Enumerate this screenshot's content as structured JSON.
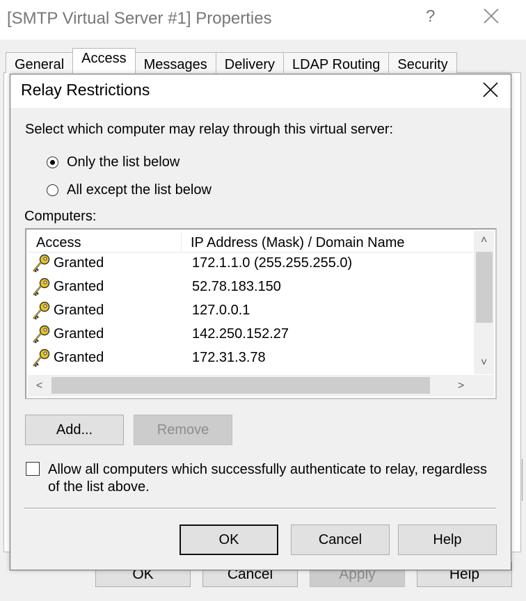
{
  "parent": {
    "title": "[SMTP Virtual Server #1] Properties",
    "help_glyph": "?",
    "tabs": [
      {
        "label": "General"
      },
      {
        "label": "Access"
      },
      {
        "label": "Messages"
      },
      {
        "label": "Delivery"
      },
      {
        "label": "LDAP Routing"
      },
      {
        "label": "Security"
      }
    ],
    "active_tab": "Access",
    "buttons": {
      "ok": "OK",
      "cancel": "Cancel",
      "apply": "Apply",
      "help": "Help"
    }
  },
  "dialog": {
    "title": "Relay Restrictions",
    "prompt": "Select which computer may relay through this virtual server:",
    "radio_only": "Only the list below",
    "radio_all_except": "All except the list below",
    "selected_radio": "Only the list below",
    "computers_label": "Computers:",
    "columns": {
      "access": "Access",
      "ip": "IP Address (Mask) / Domain Name"
    },
    "rows": [
      {
        "access": "Granted",
        "ip": "172.1.1.0 (255.255.255.0)",
        "icon": "key-icon"
      },
      {
        "access": "Granted",
        "ip": "52.78.183.150",
        "icon": "key-icon"
      },
      {
        "access": "Granted",
        "ip": "127.0.0.1",
        "icon": "key-icon"
      },
      {
        "access": "Granted",
        "ip": "142.250.152.27",
        "icon": "key-icon"
      },
      {
        "access": "Granted",
        "ip": "172.31.3.78",
        "icon": "key-icon"
      }
    ],
    "add_button": "Add...",
    "remove_button": "Remove",
    "allow_authenticated_label": "Allow all computers which successfully authenticate to relay, regardless of the list above.",
    "allow_authenticated_checked": false,
    "buttons": {
      "ok": "OK",
      "cancel": "Cancel",
      "help": "Help"
    }
  },
  "colors": {
    "dialog_bg": "#f0f0f0",
    "titlebar_bg": "#ffffff",
    "button_bg": "#e1e1e1",
    "key_icon_yellow": "#e8c21f"
  }
}
